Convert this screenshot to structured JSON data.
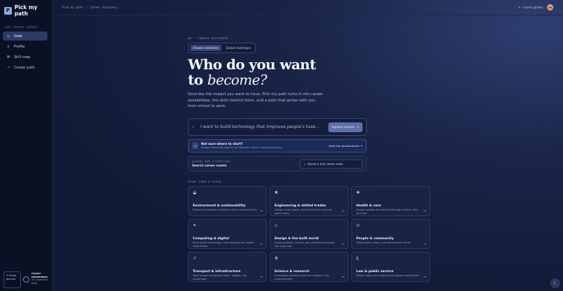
{
  "brand": {
    "logo_letter": "P",
    "name": "Pick my path"
  },
  "sidebar": {
    "heading": "YOUR CAREER JOURNEY",
    "items": [
      {
        "label": "Goal",
        "icon": "target-icon",
        "glyph": "◎"
      },
      {
        "label": "Profile",
        "icon": "person-icon",
        "glyph": "♙"
      },
      {
        "label": "Skill map",
        "icon": "map-icon",
        "glyph": "⌘"
      },
      {
        "label": "Career path",
        "icon": "trend-icon",
        "glyph": "↗"
      }
    ],
    "reset_label": "↺ Reset planner",
    "momentum_title": "Career momentum",
    "momentum_text": "0% evidence built",
    "momentum_value": "0%"
  },
  "topbar": {
    "crumbs": [
      "Pick my path",
      "Career discovery"
    ],
    "separator": "/",
    "guided_label": "Career guided",
    "avatar_initials": "UA"
  },
  "hero": {
    "eyebrow": "01 · CAREER DISCOVERY",
    "tabs": [
      "Choose a direction",
      "Global challenges"
    ],
    "title_line1": "Who do you want",
    "title_line2_prefix": "to ",
    "title_line2_em": "become?",
    "lede": "Describe the impact you want to have. Pick my path turns it into career possibilities, the skills behind them, and a path that grows with you from school to work."
  },
  "search": {
    "placeholder": "I want to build technology that improves people's lives...",
    "value": "",
    "button_label": "Explore careers"
  },
  "quiz": {
    "title": "Not sure where to start?",
    "subtitle": "Answer five quick signals and discover career routes that fit you.",
    "link": "Start the questionnaire →"
  },
  "route": {
    "label": "ALREADY HAVE A DIRECTION?",
    "title": "Search career routes",
    "select_label": "Select a real career route"
  },
  "fields": {
    "heading": "START FROM A FIELD",
    "items": [
      {
        "icon": "globe-icon",
        "glyph": "◒",
        "title": "Environment & sustainability",
        "desc": "Protect ecosystems and build a more resilient future"
      },
      {
        "icon": "wrench-icon",
        "glyph": "✖",
        "title": "Engineering & skilled trades",
        "desc": "Design, build, repair, and improve the physical world works"
      },
      {
        "icon": "plus-icon",
        "glyph": "✚",
        "title": "Health & care",
        "desc": "Support people and animals through science, skill, and care"
      },
      {
        "icon": "sparkle-icon",
        "glyph": "✦",
        "title": "Computing & digital",
        "desc": "Build useful technology, data systems, and digital experiences"
      },
      {
        "icon": "diamond-icon",
        "glyph": "◇",
        "title": "Design & the built world",
        "desc": "Shape products, spaces, and experiences people use every day"
      },
      {
        "icon": "community-icon",
        "glyph": "⊙",
        "title": "People & community",
        "desc": "Help people, teams, and communities thrive"
      },
      {
        "icon": "arrow-up-right-icon",
        "glyph": "↗",
        "title": "Transport & infrastructure",
        "desc": "Move people and goods safely, reliably, and sustainably"
      },
      {
        "icon": "atom-icon",
        "glyph": "❋",
        "title": "Science & research",
        "desc": "Investigate questions and turn evidence into understanding"
      },
      {
        "icon": "scales-icon",
        "glyph": "§",
        "title": "Law & public service",
        "desc": "Protect rights and make public systems work better"
      }
    ]
  },
  "help": {
    "glyph": "☾"
  }
}
